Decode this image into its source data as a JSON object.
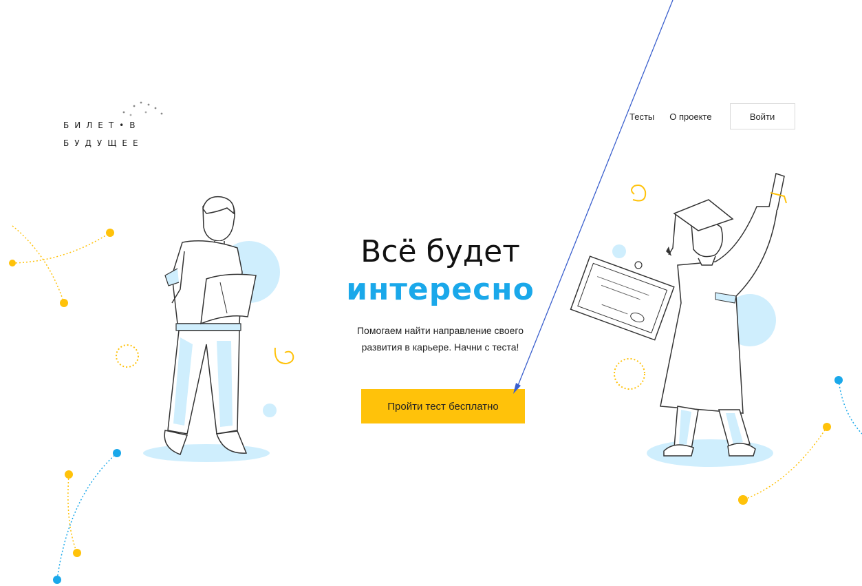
{
  "logo": {
    "line1": "БИЛЕТ•В",
    "line2": "БУДУЩЕЕ"
  },
  "nav": {
    "tests": "Тесты",
    "about": "О проекте",
    "login": "Войти"
  },
  "hero": {
    "title_line1": "Всё будет",
    "title_line2": "интересно",
    "subtitle_line1": "Помогаем найти направление своего",
    "subtitle_line2": "развития в карьере. Начни с теста!",
    "cta": "Пройти тест бесплатно"
  },
  "colors": {
    "accent_blue": "#1aa8ea",
    "accent_yellow": "#ffc20a",
    "light_blue": "#cfeefd",
    "annotation_arrow": "#3a5fcd"
  },
  "icons": {
    "left_illustration": "student-reading-illustration",
    "right_illustration": "graduate-with-diploma-illustration",
    "annotation": "arrow-annotation"
  }
}
